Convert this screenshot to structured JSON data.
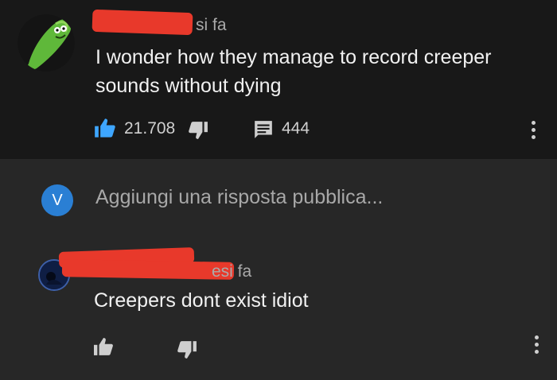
{
  "comment": {
    "time_suffix": "si fa",
    "text": "I wonder how they manage to record creeper sounds without dying",
    "likes": "21.708",
    "replies_count": "444"
  },
  "reply_box": {
    "avatar_letter": "V",
    "placeholder": "Aggiungi una risposta pubblica..."
  },
  "reply": {
    "time_suffix": "esi fa",
    "text": "Creepers dont exist idiot"
  },
  "colors": {
    "background_top": "#181818",
    "background_bottom": "#272727",
    "like_active": "#3ea6ff",
    "avatar_user": "#2a7fd4",
    "redaction": "#e8392b"
  }
}
